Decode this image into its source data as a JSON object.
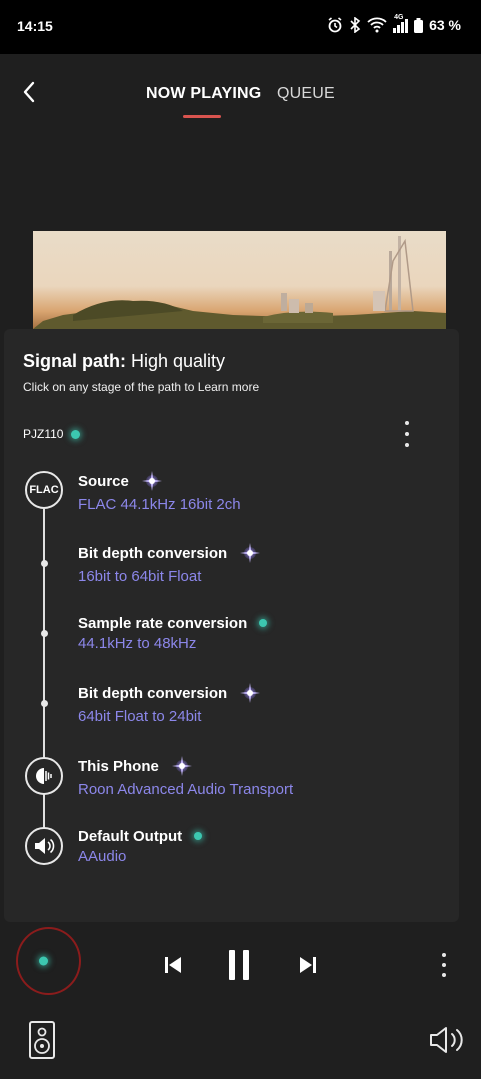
{
  "status": {
    "time": "14:15",
    "network": "4G",
    "battery": "63 %"
  },
  "nav": {
    "tabs": [
      {
        "label": "NOW PLAYING",
        "active": true
      },
      {
        "label": "QUEUE",
        "active": false
      }
    ],
    "accent": "#d9544f"
  },
  "signal_path": {
    "title_bold": "Signal path:",
    "title_rest": " High quality",
    "subtitle": "Click on any stage of the path to Learn more",
    "zone": "PJZ110",
    "stages": [
      {
        "name": "Source",
        "detail": "FLAC 44.1kHz 16bit 2ch",
        "quality": "enhanced",
        "icon": "flac-badge-icon"
      },
      {
        "name": "Bit depth conversion",
        "detail": "16bit to 64bit Float",
        "quality": "enhanced"
      },
      {
        "name": "Sample rate conversion",
        "detail": "44.1kHz to 48kHz",
        "quality": "high"
      },
      {
        "name": "Bit depth conversion",
        "detail": "64bit Float to 24bit",
        "quality": "enhanced"
      },
      {
        "name": "This Phone",
        "detail": "Roon Advanced Audio Transport",
        "quality": "enhanced",
        "icon": "phone-speaker-icon"
      },
      {
        "name": "Default Output",
        "detail": "AAudio",
        "quality": "high",
        "icon": "speaker-icon"
      }
    ],
    "flac_label": "FLAC",
    "colors": {
      "detail": "#8c87ea",
      "teal": "#3cc7b0",
      "enhanced": "#a08cff"
    }
  },
  "player": {
    "state": "playing"
  }
}
